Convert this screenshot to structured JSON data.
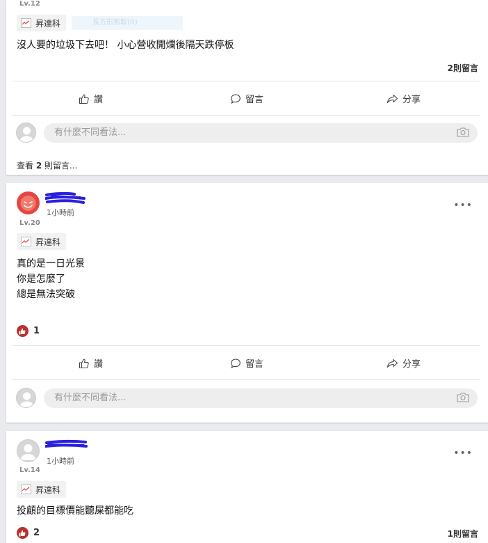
{
  "posts": [
    {
      "level": "Lv.12",
      "tag": "昇達科",
      "faded_tag": "長方形剪取(R)",
      "text": "沒人要的垃圾下去吧！ 小心營收開爛後隔天跌停板",
      "comment_count": "2則留言",
      "actions": {
        "like": "讚",
        "comment": "留言",
        "share": "分享"
      },
      "comment_placeholder": "有什麼不同看法...",
      "view_comments_prefix": "查看 ",
      "view_comments_number": "2",
      "view_comments_suffix": " 則留言..."
    },
    {
      "time": "1小時前",
      "level": "Lv.20",
      "tag": "昇達科",
      "lines": [
        "真的是一日光景",
        "你是怎麼了",
        "總是無法突破"
      ],
      "likes": "1",
      "actions": {
        "like": "讚",
        "comment": "留言",
        "share": "分享"
      },
      "comment_placeholder": "有什麼不同看法...",
      "more": "•••"
    },
    {
      "time": "1小時前",
      "level": "Lv.14",
      "tag": "昇達科",
      "text": "投顧的目標價能聽屎都能吃",
      "likes": "2",
      "comment_count": "1則留言",
      "more": "•••"
    }
  ],
  "colors": {
    "like_badge": "#b8302f",
    "scribble": "#2a1fe0",
    "background": "#e9ebee"
  },
  "icons": [
    "thumbs-up-icon",
    "speech-bubble-icon",
    "share-arrow-icon",
    "camera-icon",
    "stock-chart-icon",
    "more-icon"
  ]
}
